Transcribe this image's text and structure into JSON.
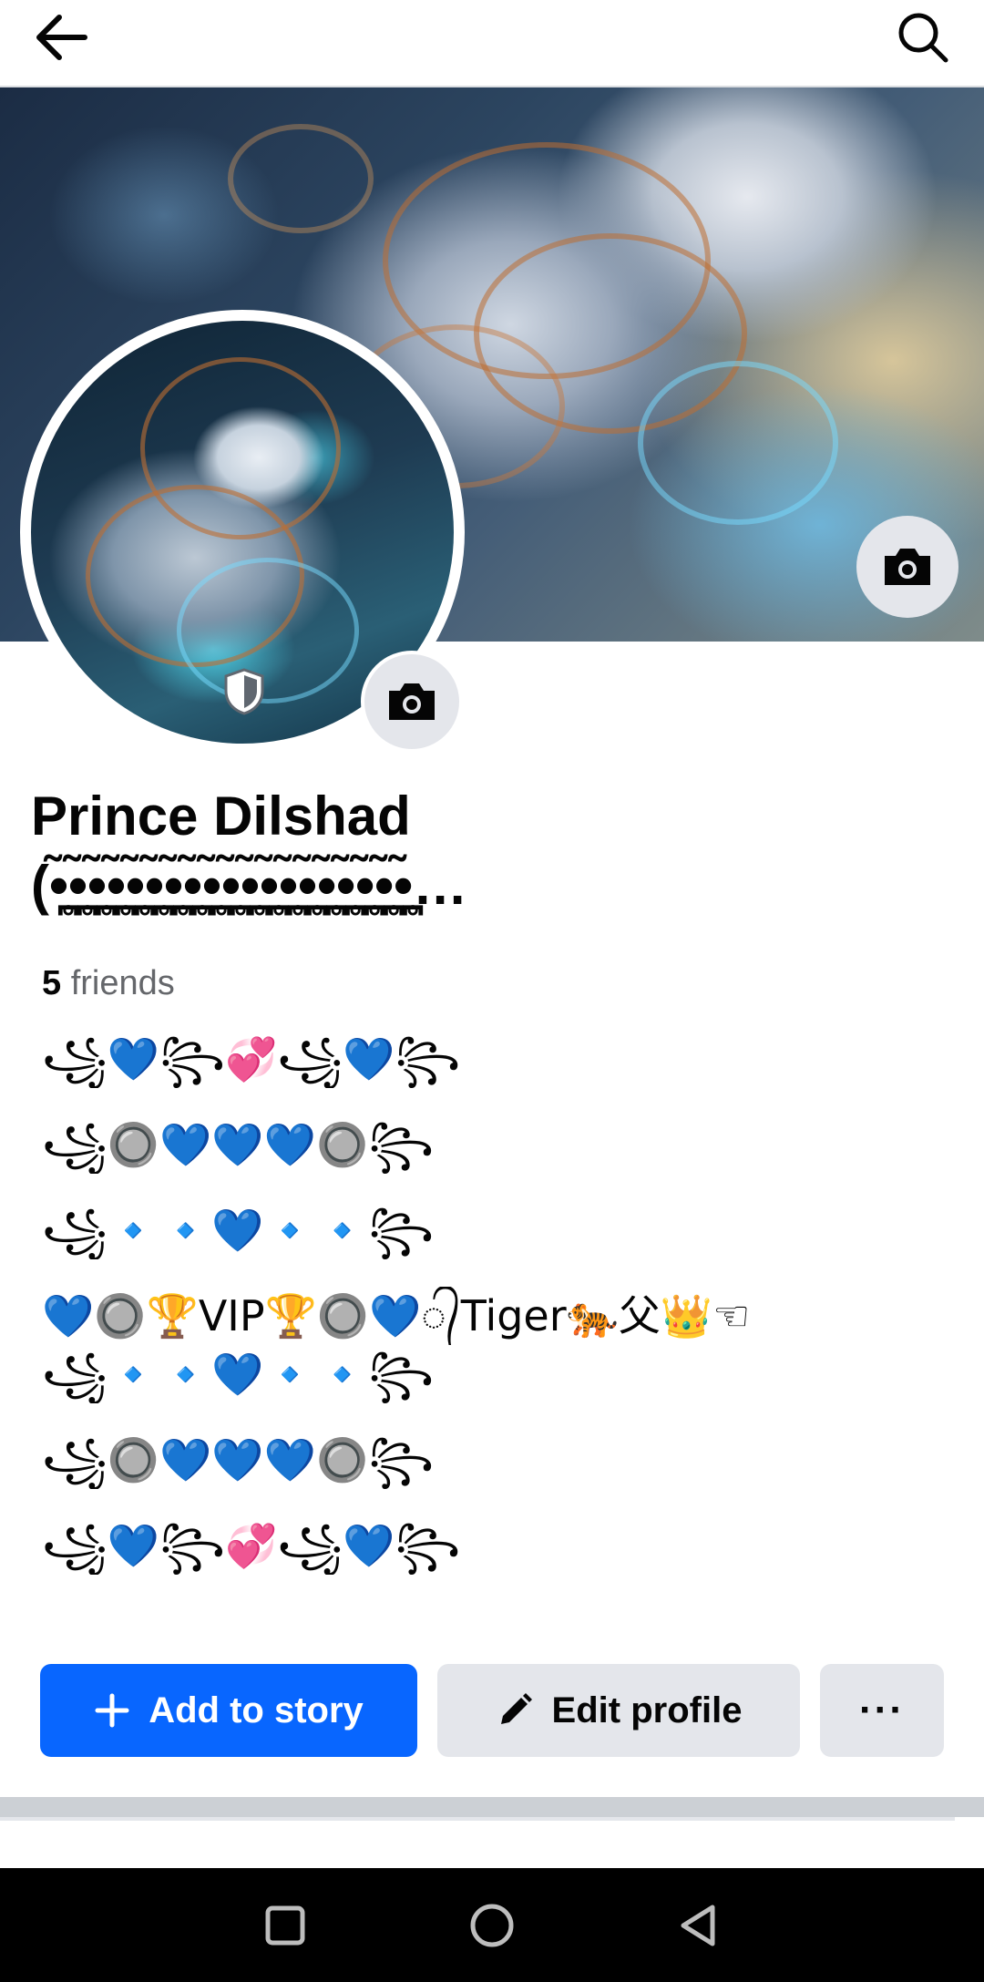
{
  "header": {
    "back_icon": "arrow-left-icon",
    "search_icon": "search-icon"
  },
  "profile": {
    "name_line1": "Prince Dilshad",
    "name_line2": "(•̪̥̃•̪̥̃•̪̥̃•̪̥̃•̪̥̃•̪̥̃•̪̥̃•̪̥̃•̪̥̃•̪̥̃•̪̥̃•̪̥̃•̪̥̃•̪̥̃•̪̥̃•̪̥̃•̪̥̃•̪̥̃•̪̥̃…",
    "friends_count": "5",
    "friends_label": " friends",
    "bio_lines": [
      "꧁💙꧂💞꧁💙꧂",
      "꧁🔘💙💙💙🔘꧂",
      "꧁🔹🔹💙🔹🔹꧂",
      "💙🔘🏆VIP🏆🔘💙᭄Tiger🐅父👑☜",
      "꧁🔹🔹💙🔹🔹꧂",
      "꧁🔘💙💙💙🔘꧂",
      "꧁💙꧂💞꧁💙꧂"
    ]
  },
  "actions": {
    "add_story_label": "Add to story",
    "edit_profile_label": "Edit profile",
    "more_label": "···"
  },
  "colors": {
    "primary_button": "#0866ff",
    "secondary_button": "#e4e6eb",
    "muted_text": "#65676b"
  },
  "nav": {
    "recent_icon": "square-icon",
    "home_icon": "circle-icon",
    "back_icon": "triangle-back-icon"
  }
}
